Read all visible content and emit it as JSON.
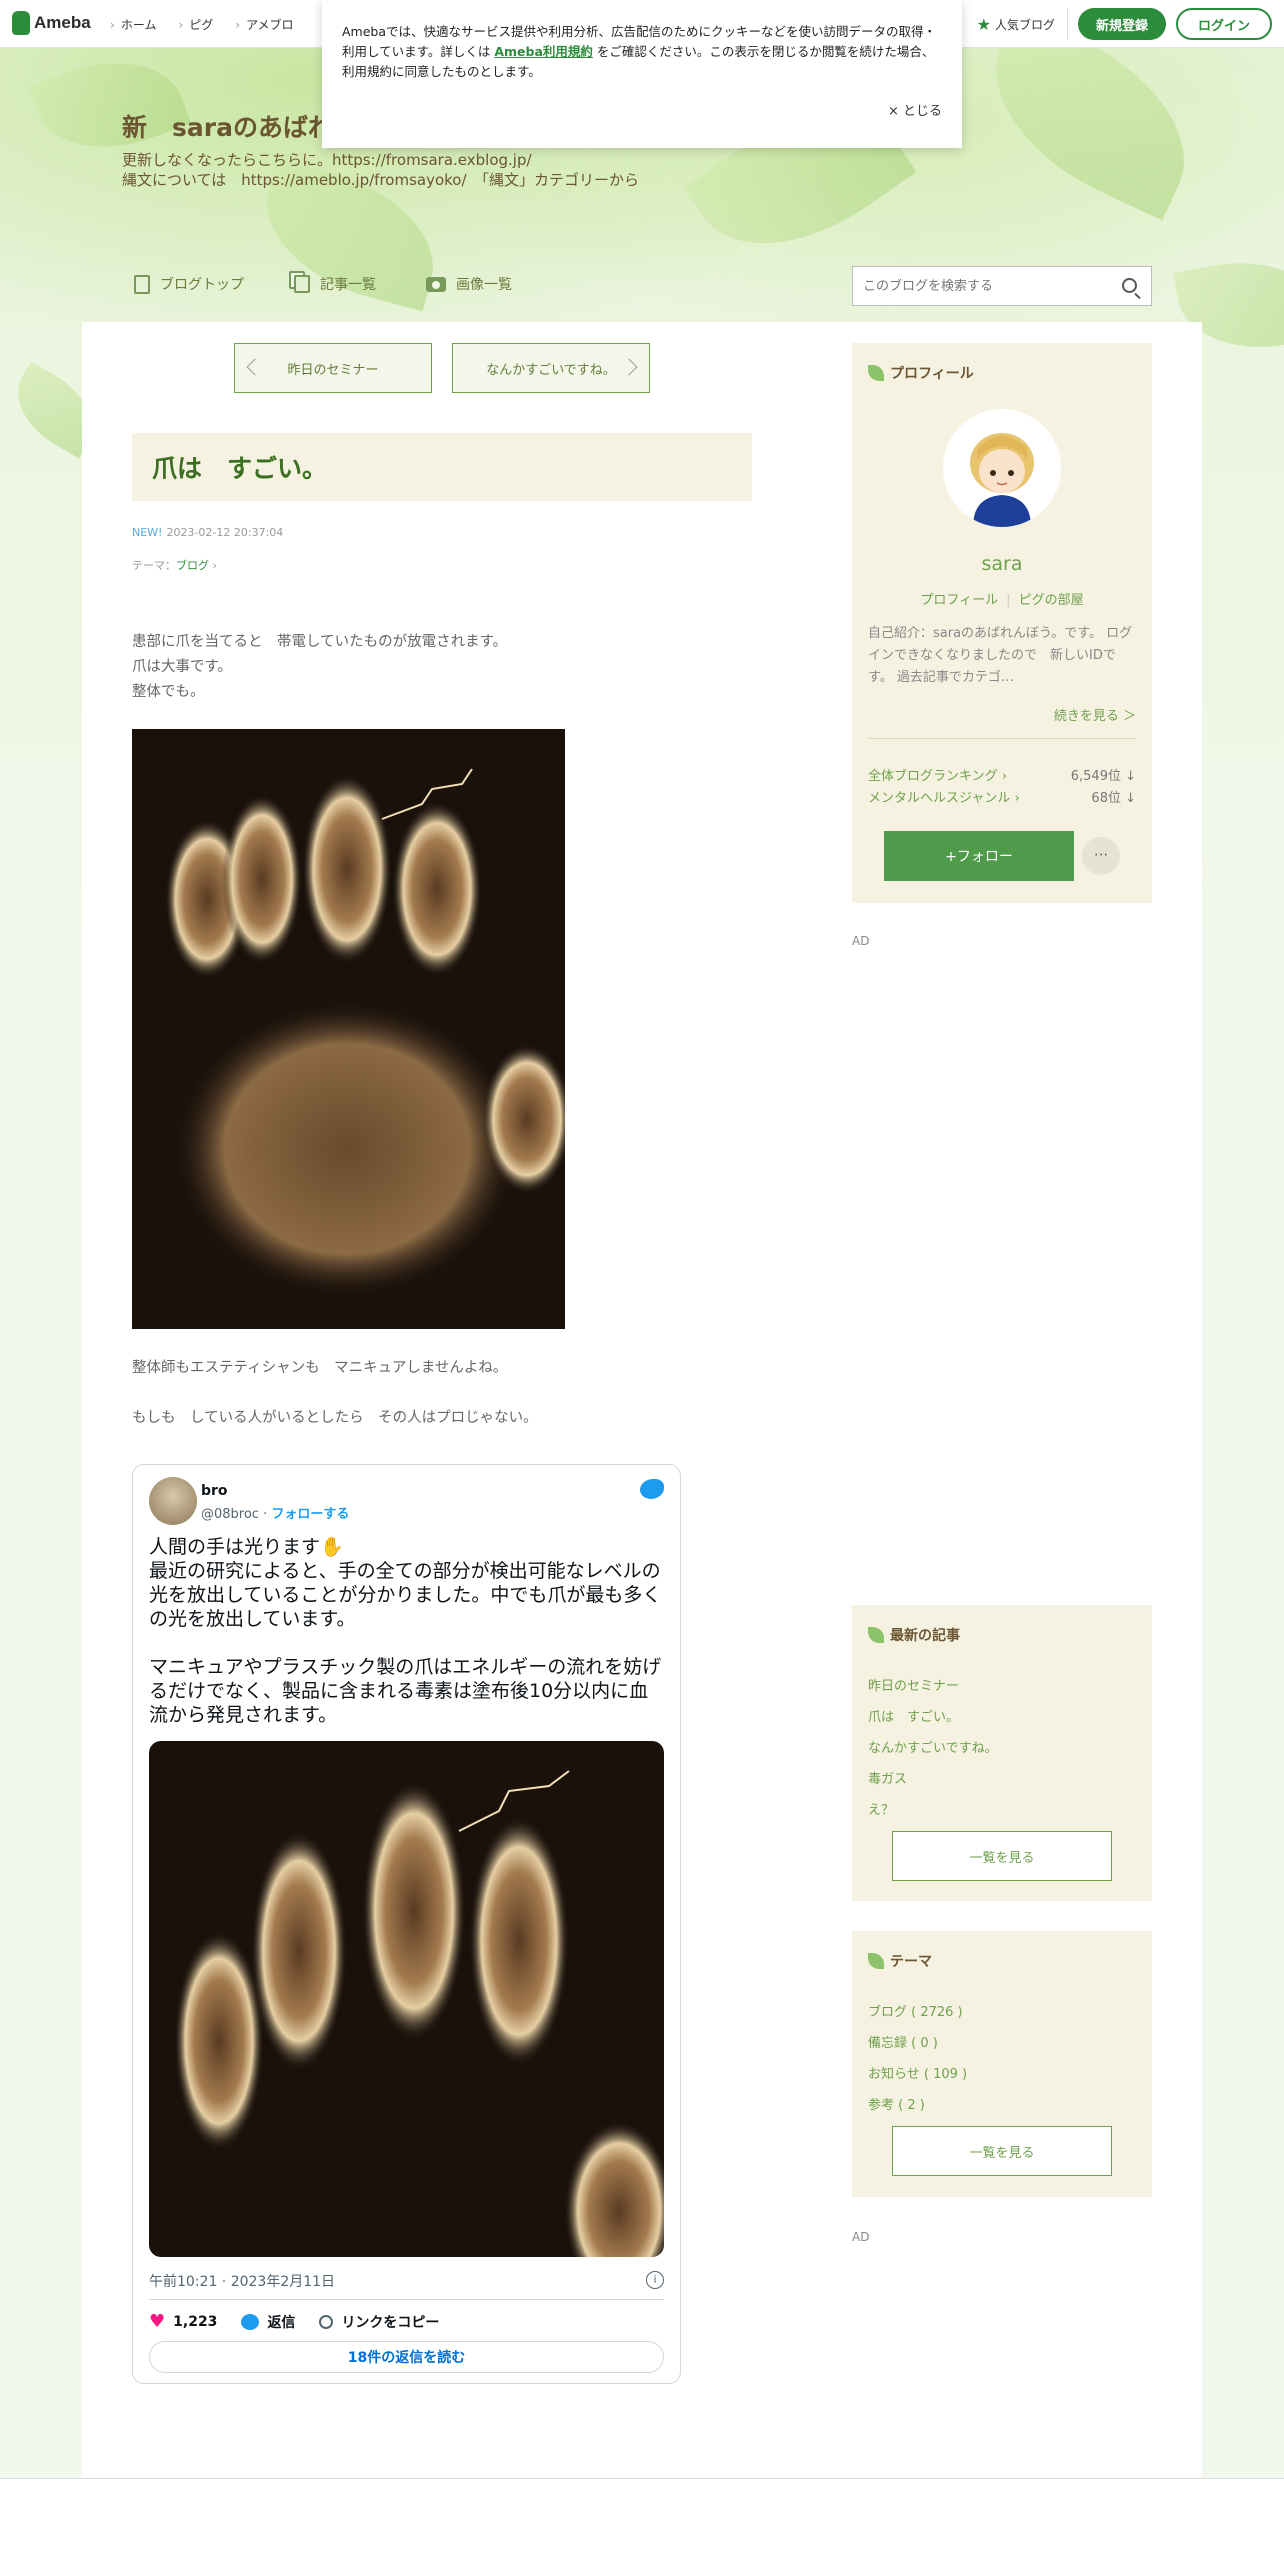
{
  "topbar": {
    "logo": "Ameba",
    "nav": [
      "ホーム",
      "ピグ",
      "アメブロ"
    ],
    "popular": "人気ブログ",
    "register": "新規登録",
    "login": "ログイン"
  },
  "cookie": {
    "text_before": "Amebaでは、快適なサービス提供や利用分析、広告配信のためにクッキーなどを使い訪問データの取得・利用しています。詳しくは ",
    "link": "Ameba利用規約",
    "text_after": " をご確認ください。この表示を閉じるか閲覧を続けた場合、利用規約に同意したものとします。",
    "close": "× とじる"
  },
  "blog": {
    "title": "新　saraのあばれ",
    "desc_line1": "更新しなくなったらこちらに。https://fromsara.exblog.jp/",
    "desc_line2": "縄文については　https://ameblo.jp/fromsayoko/　「縄文」カテゴリーから",
    "nav": [
      "ブログトップ",
      "記事一覧",
      "画像一覧"
    ],
    "search_placeholder": "このブログを検索する"
  },
  "pager": {
    "prev": "昨日のセミナー",
    "next": "なんかすごいですね。"
  },
  "entry": {
    "title": "爪は　すごい。",
    "new_label": "NEW!",
    "date": "2023-02-12 20:37:04",
    "theme_label": "テーマ：",
    "theme": "ブログ",
    "body1": [
      "患部に爪を当てると　帯電していたものが放電されます。",
      "爪は大事です。",
      "整体でも。"
    ],
    "body2": [
      "整体師もエステティシャンも　マニキュアしませんよね。",
      "",
      "もしも　している人がいるとしたら　その人はプロじゃない。"
    ]
  },
  "tweet": {
    "name": "bro",
    "handle": "@08broc",
    "follow": "フォローする",
    "text": "人間の手は光ります✋\n最近の研究によると、手の全ての部分が検出可能なレベルの光を放出していることが分かりました。中でも爪が最も多くの光を放出しています。\n\nマニキュアやプラスチック製の爪はエネルギーの流れを妨げるだけでなく、製品に含まれる毒素は塗布後10分以内に血流から発見されます。",
    "time": "午前10:21 · 2023年2月11日",
    "likes": "1,223",
    "reply": "返信",
    "copy_link": "リンクをコピー",
    "read_replies": "18件の返信を読む"
  },
  "profile": {
    "heading": "プロフィール",
    "name": "sara",
    "link1": "プロフィール",
    "link2": "ピグの部屋",
    "intro": "自己紹介：saraのあばれんぼう。です。 ログインできなくなりましたので　新しいIDです。 過去記事でカテゴ…",
    "more": "続きを見る ＞",
    "rank1_label": "全体ブログランキング",
    "rank1_value": "6,549位 ↓",
    "rank2_label": "メンタルヘルスジャンル",
    "rank2_value": "68位 ↓",
    "follow": "+フォロー",
    "more_menu": "···"
  },
  "ad_label": "AD",
  "recent": {
    "heading": "最新の記事",
    "items": [
      "昨日のセミナー",
      "爪は　すごい。",
      "なんかすごいですね。",
      "毒ガス",
      "え？"
    ],
    "button": "一覧を見る"
  },
  "themes": {
    "heading": "テーマ",
    "items": [
      "ブログ ( 2726 )",
      "備忘録 ( 0 )",
      "お知らせ ( 109 )",
      "参考 ( 2 )"
    ],
    "button": "一覧を見る"
  }
}
